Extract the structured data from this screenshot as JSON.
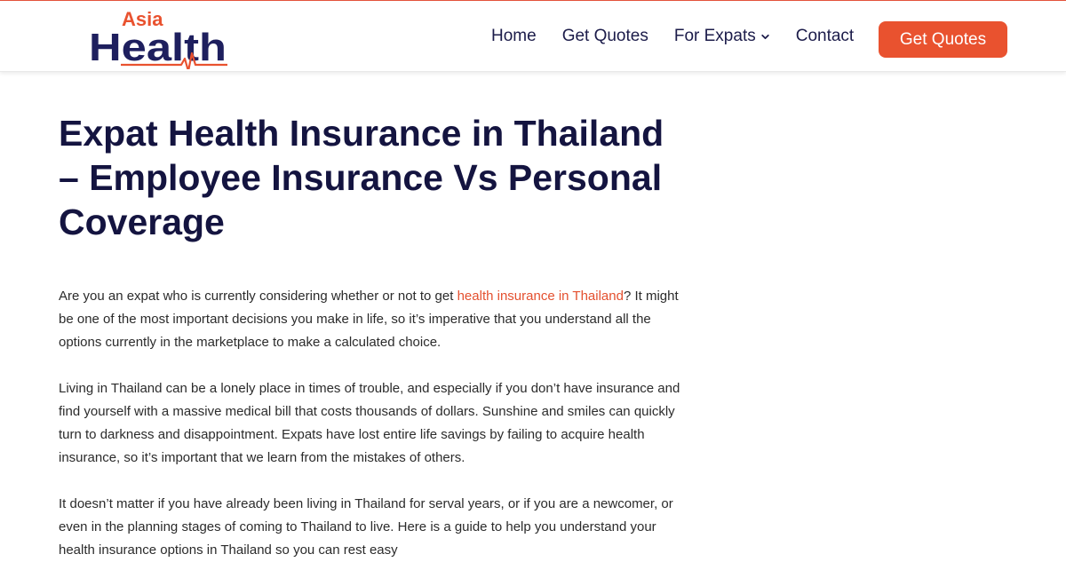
{
  "brand": {
    "logo_top": "Asia",
    "logo_bottom": "Health",
    "colors": {
      "navy": "#1e1f5e",
      "orange": "#e9522f"
    }
  },
  "nav": {
    "items": [
      {
        "label": "Home"
      },
      {
        "label": "Get Quotes"
      },
      {
        "label": "For Expats",
        "icon": "chevron-down-icon"
      },
      {
        "label": "Contact"
      }
    ],
    "cta_label": "Get Quotes"
  },
  "article": {
    "title": "Expat Health Insurance in Thailand – Employee Insurance Vs Personal Coverage",
    "paragraphs": [
      {
        "before": "Are you an expat who is currently considering whether or not to get ",
        "link": "health insurance in Thailand",
        "after": "? It might be one of the most important decisions you make in life, so it’s imperative that you understand all the options currently in the marketplace to make a calculated choice."
      },
      {
        "text": "Living in Thailand can be a lonely place in times of trouble, and especially if you don’t have insurance and find yourself with a massive medical bill that costs thousands of dollars. Sunshine and smiles can quickly turn to darkness and disappointment. Expats have lost entire life savings by failing to acquire health insurance, so it’s important that we learn from the mistakes of others."
      },
      {
        "text": "It doesn’t matter if you have already been living in Thailand for serval years, or if you are a newcomer, or even in the planning stages of coming to Thailand to live. Here is a guide to help you understand your health insurance options in Thailand so you can rest easy"
      }
    ]
  }
}
